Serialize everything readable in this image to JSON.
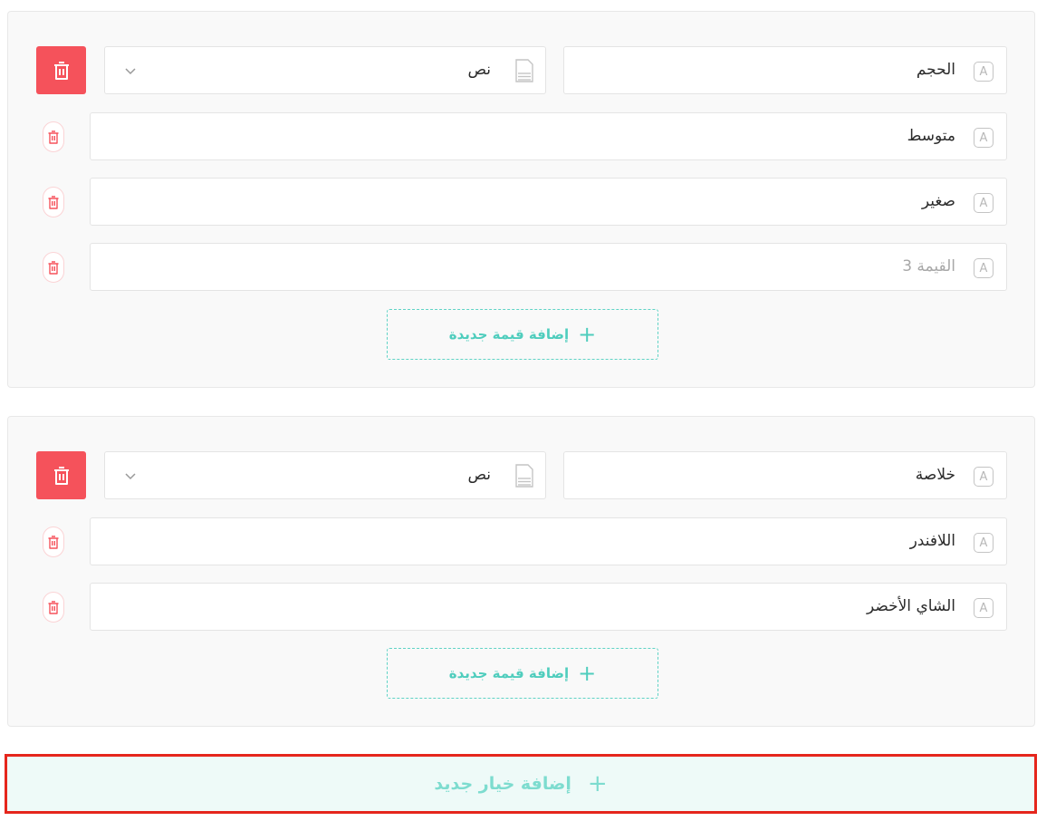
{
  "options": [
    {
      "name": "الحجم",
      "type": "نص",
      "values": [
        {
          "text": "متوسط",
          "placeholder": false
        },
        {
          "text": "صغير",
          "placeholder": false
        },
        {
          "text": "القيمة 3",
          "placeholder": true
        }
      ],
      "add_value_label": "إضافة قيمة جديدة"
    },
    {
      "name": "خلاصة",
      "type": "نص",
      "values": [
        {
          "text": "اللافندر",
          "placeholder": false
        },
        {
          "text": "الشاي الأخضر",
          "placeholder": false
        }
      ],
      "add_value_label": "إضافة قيمة جديدة"
    }
  ],
  "add_option_label": "إضافة خيار جديد",
  "field_icon_glyph": "A",
  "plus_glyph": "+",
  "colors": {
    "accent": "#4fcdbd",
    "danger": "#f5525b",
    "highlight_border": "#e5261c"
  }
}
